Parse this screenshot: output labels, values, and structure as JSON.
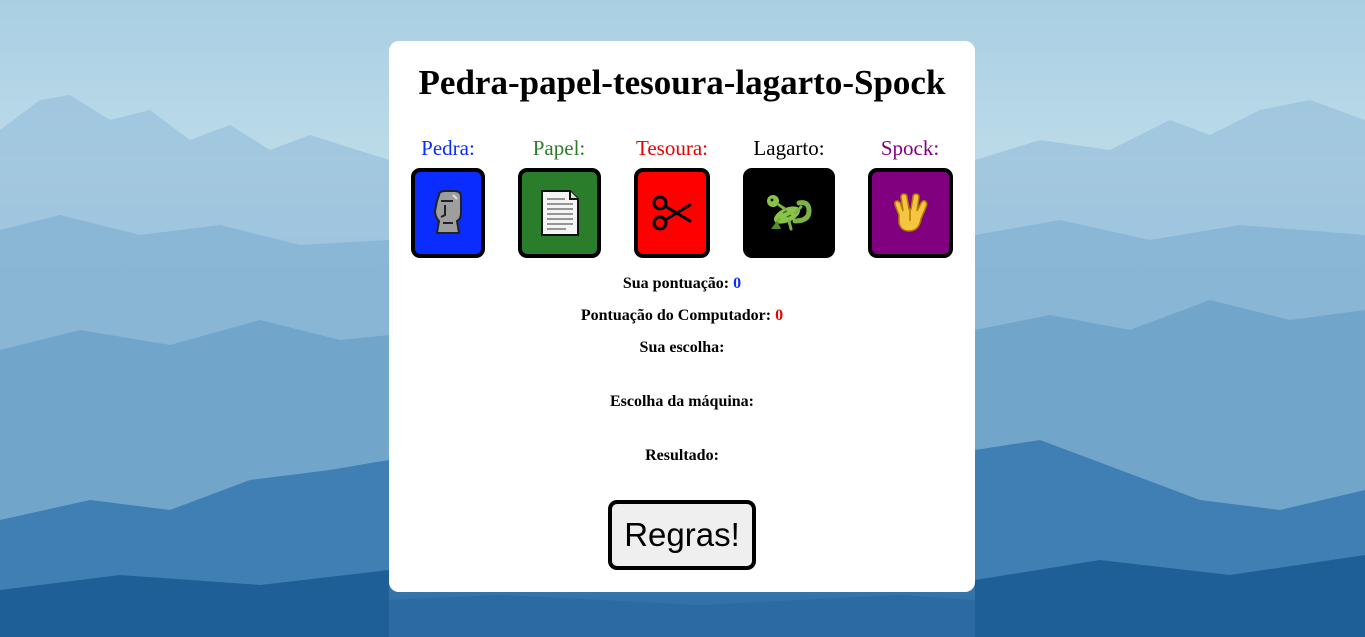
{
  "title": "Pedra-papel-tesoura-lagarto-Spock",
  "choices": [
    {
      "label": "Pedra:",
      "color": "#0a2cff",
      "bg": "#0a2cff",
      "icon": "moai-icon"
    },
    {
      "label": "Papel:",
      "color": "#2a7d2a",
      "bg": "#2a7d2a",
      "icon": "page-icon"
    },
    {
      "label": "Tesoura:",
      "color": "#e60000",
      "bg": "#ff0000",
      "icon": "scissors-icon"
    },
    {
      "label": "Lagarto:",
      "color": "#000000",
      "bg": "#000000",
      "icon": "lizard-icon"
    },
    {
      "label": "Spock:",
      "color": "#800080",
      "bg": "#800080",
      "icon": "vulcan-salute-icon"
    }
  ],
  "score": {
    "user_label": "Sua pontuação:",
    "user_value": "0",
    "user_color": "#0a2cff",
    "computer_label": "Pontuação do Computador:",
    "computer_value": "0",
    "computer_color": "#e60000"
  },
  "your_choice_label": "Sua escolha:",
  "machine_choice_label": "Escolha da máquina:",
  "result_label": "Resultado:",
  "rules_button": "Regras!"
}
